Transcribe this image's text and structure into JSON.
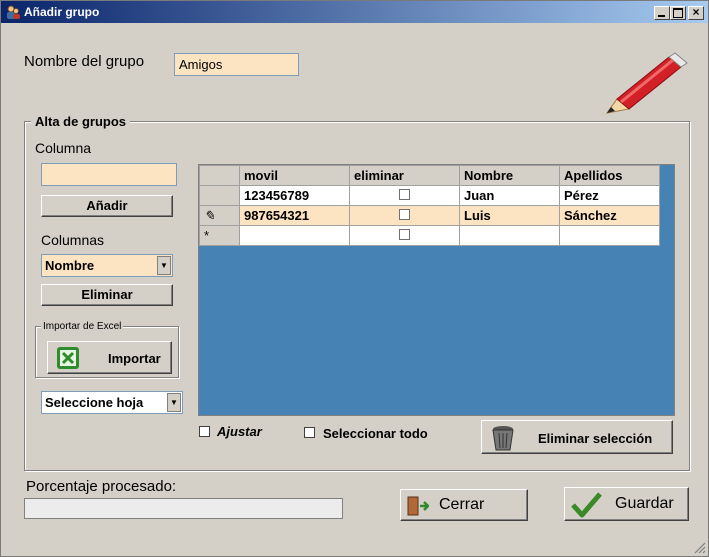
{
  "window": {
    "title": "Añadir grupo"
  },
  "group_name": {
    "label": "Nombre del grupo",
    "value": "Amigos"
  },
  "section": {
    "title": "Alta de grupos"
  },
  "column": {
    "label": "Columna",
    "value": "",
    "add_label": "Añadir"
  },
  "columns": {
    "label": "Columnas",
    "selected": "Nombre",
    "remove_label": "Eliminar"
  },
  "excel": {
    "group_title": "Importar de Excel",
    "import_label": "Importar"
  },
  "sheet": {
    "selected": "Seleccione hoja"
  },
  "grid": {
    "headers": [
      "movil",
      "eliminar",
      "Nombre",
      "Apellidos"
    ],
    "rows": [
      {
        "marker": "",
        "movil": "123456789",
        "checked": false,
        "nombre": "Juan",
        "apellidos": "Pérez"
      },
      {
        "marker": "✎",
        "movil": "987654321",
        "checked": false,
        "nombre": "Luis",
        "apellidos": "Sánchez"
      },
      {
        "marker": "*",
        "movil": "",
        "checked": false,
        "nombre": "",
        "apellidos": ""
      }
    ]
  },
  "options": {
    "ajustar": "Ajustar",
    "select_all": "Seleccionar todo",
    "delete_selection": "Eliminar selección"
  },
  "progress": {
    "label": "Porcentaje procesado:",
    "percent": 0
  },
  "footer": {
    "close_label": "Cerrar",
    "save_label": "Guardar"
  }
}
